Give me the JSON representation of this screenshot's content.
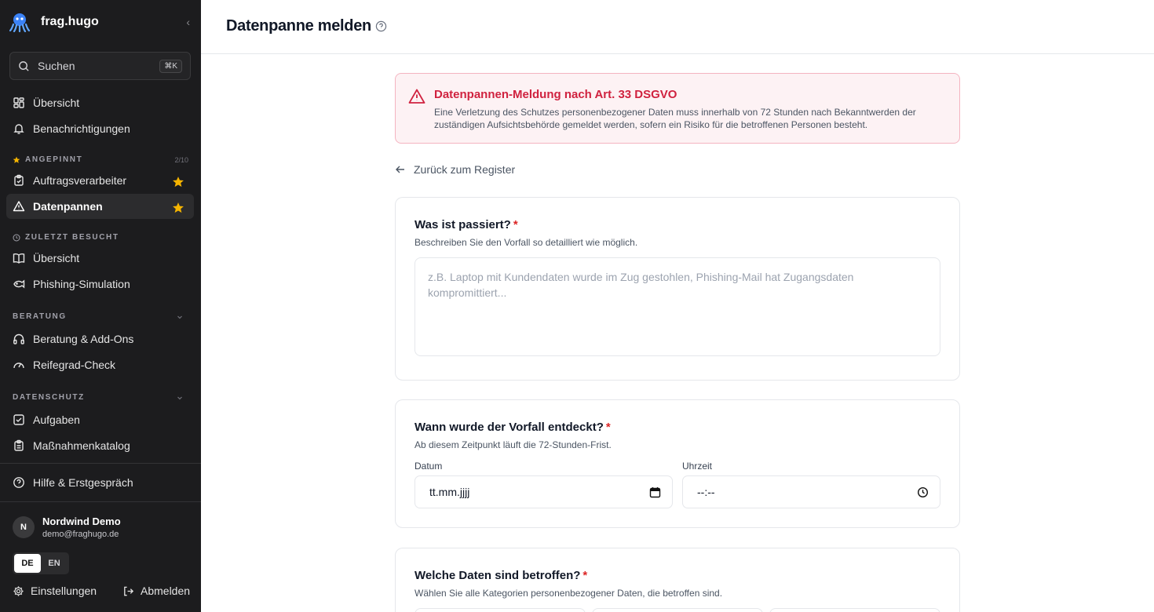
{
  "sidebar": {
    "brand": "frag.hugo",
    "search": {
      "placeholder": "Suchen",
      "shortcut": "⌘K"
    },
    "nav_top": [
      {
        "label": "Übersicht",
        "icon": "dashboard-icon"
      },
      {
        "label": "Benachrichtigungen",
        "icon": "bell-icon"
      }
    ],
    "pinned": {
      "title": "ANGEPINNT",
      "count": "2/10",
      "items": [
        {
          "label": "Auftragsverarbeiter",
          "icon": "clipboard-icon"
        },
        {
          "label": "Datenpannen",
          "icon": "warning-icon"
        }
      ]
    },
    "recent": {
      "title": "ZULETZT BESUCHT",
      "items": [
        {
          "label": "Übersicht",
          "icon": "book-icon"
        },
        {
          "label": "Phishing-Simulation",
          "icon": "fish-icon"
        }
      ]
    },
    "beratung": {
      "title": "BERATUNG",
      "items": [
        {
          "label": "Beratung & Add-Ons",
          "icon": "headphones-icon"
        },
        {
          "label": "Reifegrad-Check",
          "icon": "gauge-icon"
        }
      ]
    },
    "datenschutz": {
      "title": "DATENSCHUTZ",
      "items": [
        {
          "label": "Aufgaben",
          "icon": "checkbox-icon"
        },
        {
          "label": "Maßnahmenkatalog",
          "icon": "clipboard-list-icon"
        }
      ]
    },
    "help": "Hilfe & Erstgespräch",
    "user": {
      "initial": "N",
      "name": "Nordwind Demo",
      "email": "demo@fraghugo.de"
    },
    "lang": {
      "de": "DE",
      "en": "EN",
      "active": "DE"
    },
    "settings": "Einstellungen",
    "logout": "Abmelden"
  },
  "header": {
    "title": "Datenpanne melden"
  },
  "alert": {
    "title": "Datenpannen-Meldung nach Art. 33 DSGVO",
    "text": "Eine Verletzung des Schutzes personenbezogener Daten muss innerhalb von 72 Stunden nach Bekanntwerden der zuständigen Aufsichtsbehörde gemeldet werden, sofern ein Risiko für die betroffenen Personen besteht."
  },
  "back_link": "Zurück zum Register",
  "form": {
    "what": {
      "question": "Was ist passiert?",
      "required_mark": "*",
      "description": "Beschreiben Sie den Vorfall so detailliert wie möglich.",
      "placeholder": "z.B. Laptop mit Kundendaten wurde im Zug gestohlen, Phishing-Mail hat Zugangsdaten kompromittiert..."
    },
    "when": {
      "question": "Wann wurde der Vorfall entdeckt?",
      "required_mark": "*",
      "description": "Ab diesem Zeitpunkt läuft die 72-Stunden-Frist.",
      "date_label": "Datum",
      "date_value": "tt.mm.jjjj",
      "time_label": "Uhrzeit",
      "time_value": "--:--"
    },
    "data": {
      "question": "Welche Daten sind betroffen?",
      "required_mark": "*",
      "description": "Wählen Sie alle Kategorien personenbezogener Daten, die betroffen sind."
    }
  },
  "colors": {
    "sidebar_bg": "#1c1c1e",
    "alert_red": "#d0223f",
    "star": "#f5b400"
  }
}
